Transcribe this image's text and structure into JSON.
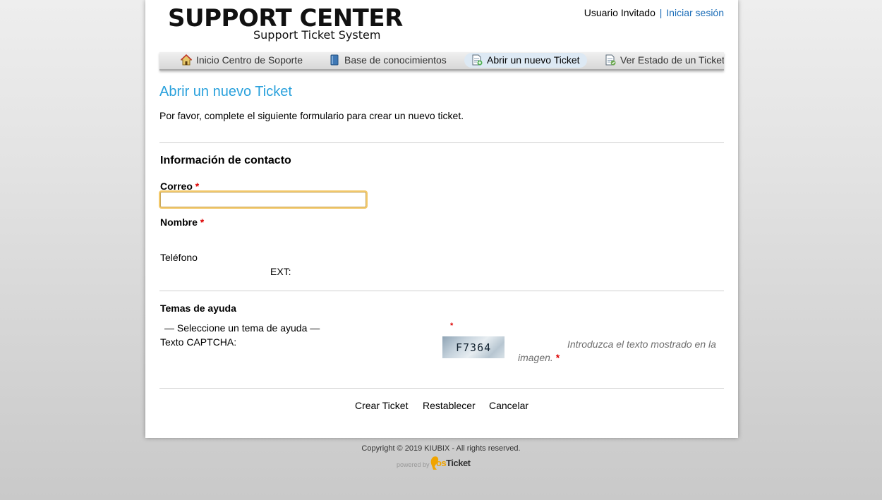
{
  "header": {
    "logo_title": "SUPPORT CENTER",
    "logo_subtitle": "Support Ticket System",
    "guest_user": "Usuario Invitado",
    "separator": "|",
    "login_link": "Iniciar sesión"
  },
  "nav": {
    "items": [
      {
        "label": "Inicio Centro de Soporte",
        "icon": "home-icon"
      },
      {
        "label": "Base de conocimientos",
        "icon": "book-icon"
      },
      {
        "label": "Abrir un nuevo Ticket",
        "icon": "new-ticket-icon",
        "active": true
      },
      {
        "label": "Ver Estado de un Ticket",
        "icon": "ticket-status-icon"
      }
    ]
  },
  "main": {
    "title": "Abrir un nuevo Ticket",
    "intro": "Por favor, complete el siguiente formulario para crear un nuevo ticket."
  },
  "contact": {
    "heading": "Información de contacto",
    "email_label": "Correo",
    "email_value": "",
    "name_label": "Nombre",
    "phone_label": "Teléfono",
    "ext_label": "EXT:",
    "required_mark": "*"
  },
  "help": {
    "heading": "Temas de ayuda",
    "topic_selected": "— Seleccione un tema de ayuda —",
    "captcha_label": "Texto CAPTCHA:",
    "captcha_code": "F7364",
    "captcha_hint": "Introduzca el texto mostrado en la imagen."
  },
  "buttons": {
    "create": "Crear Ticket",
    "reset": "Restablecer",
    "cancel": "Cancelar"
  },
  "footer": {
    "copyright": "Copyright © 2019 KIUBIX - All rights reserved.",
    "powered_by": "powered by",
    "brand_os": "os",
    "brand_ticket": "Ticket"
  },
  "colors": {
    "accent": "#2aa1dc",
    "link": "#1a6cb7",
    "required": "#dd0000"
  }
}
